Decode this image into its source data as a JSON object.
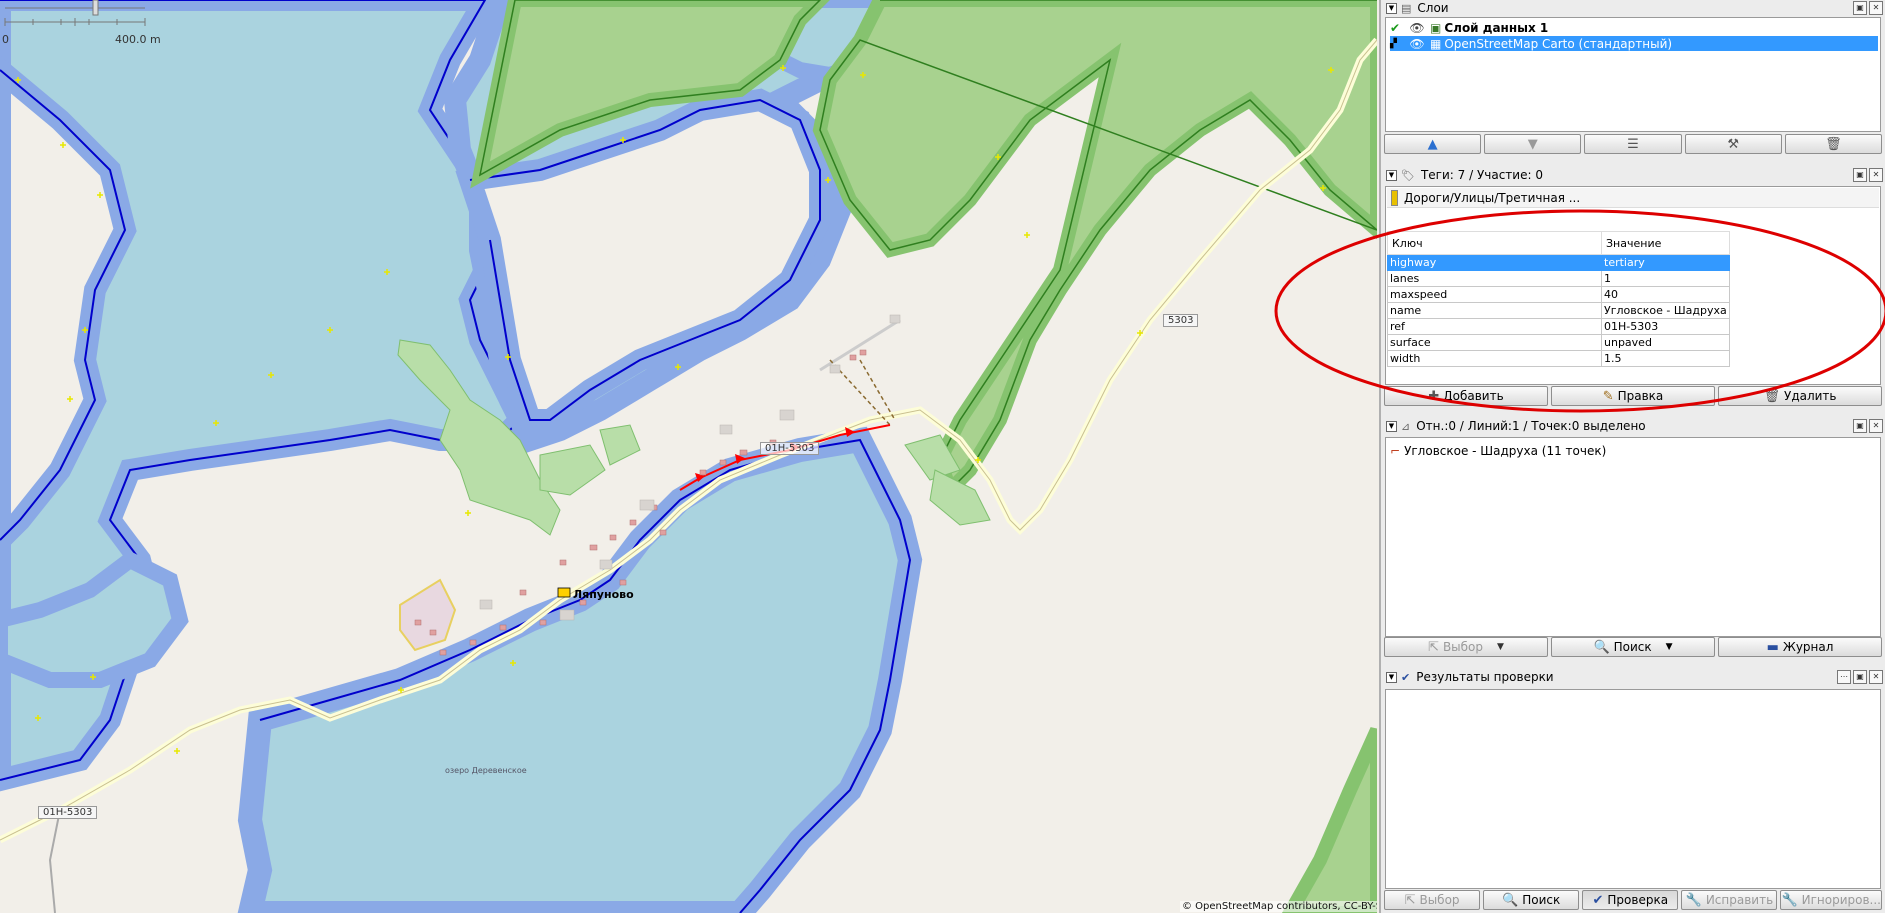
{
  "map": {
    "scale_zero": "0",
    "scale_max": "400.0 m",
    "village_name": "Ляпуново",
    "lake_name": "озеро Деревенское",
    "attribution": "© OpenStreetMap contributors, CC-BY-SA",
    "road_shields": [
      "01H-5303",
      "5303",
      "01H-5303"
    ],
    "colors": {
      "water": "#aad3df",
      "water_edge": "#8aa9e6",
      "forest": "#a8d28f",
      "forest_dark": "#86c36f",
      "land": "#f2efe9",
      "selected_way": "#ff0000"
    }
  },
  "layers_panel": {
    "title": "Слои",
    "layers": [
      {
        "name": "Слой данных 1",
        "active": true
      },
      {
        "name": "OpenStreetMap Carto (стандартный)",
        "selected": true
      }
    ],
    "buttons": [
      "up-arrow-icon",
      "down-arrow-icon",
      "activate-layer-icon",
      "layer-settings-icon",
      "delete-icon"
    ]
  },
  "tags_panel": {
    "title": "Теги: 7 / Участие: 0",
    "preset": "Дороги/Улицы/Третичная ...",
    "col_key": "Ключ",
    "col_value": "Значение",
    "rows": [
      {
        "key": "highway",
        "value": "tertiary"
      },
      {
        "key": "lanes",
        "value": "1"
      },
      {
        "key": "maxspeed",
        "value": "40"
      },
      {
        "key": "name",
        "value": "Угловское - Шадруха"
      },
      {
        "key": "ref",
        "value": "01H-5303"
      },
      {
        "key": "surface",
        "value": "unpaved"
      },
      {
        "key": "width",
        "value": "1.5"
      }
    ],
    "add_label": "Добавить",
    "edit_label": "Правка",
    "delete_label": "Удалить"
  },
  "selection_panel": {
    "title": "Отн.:0 / Линий:1 / Точек:0 выделено",
    "item": "Угловское - Шадруха (11 точек)",
    "select_label": "Выбор",
    "search_label": "Поиск",
    "history_label": "Журнал"
  },
  "validation_panel": {
    "title": "Результаты проверки",
    "select_label": "Выбор",
    "search_label": "Поиск",
    "validate_label": "Проверка",
    "fix_label": "Исправить",
    "ignore_label": "Игнориров..."
  }
}
